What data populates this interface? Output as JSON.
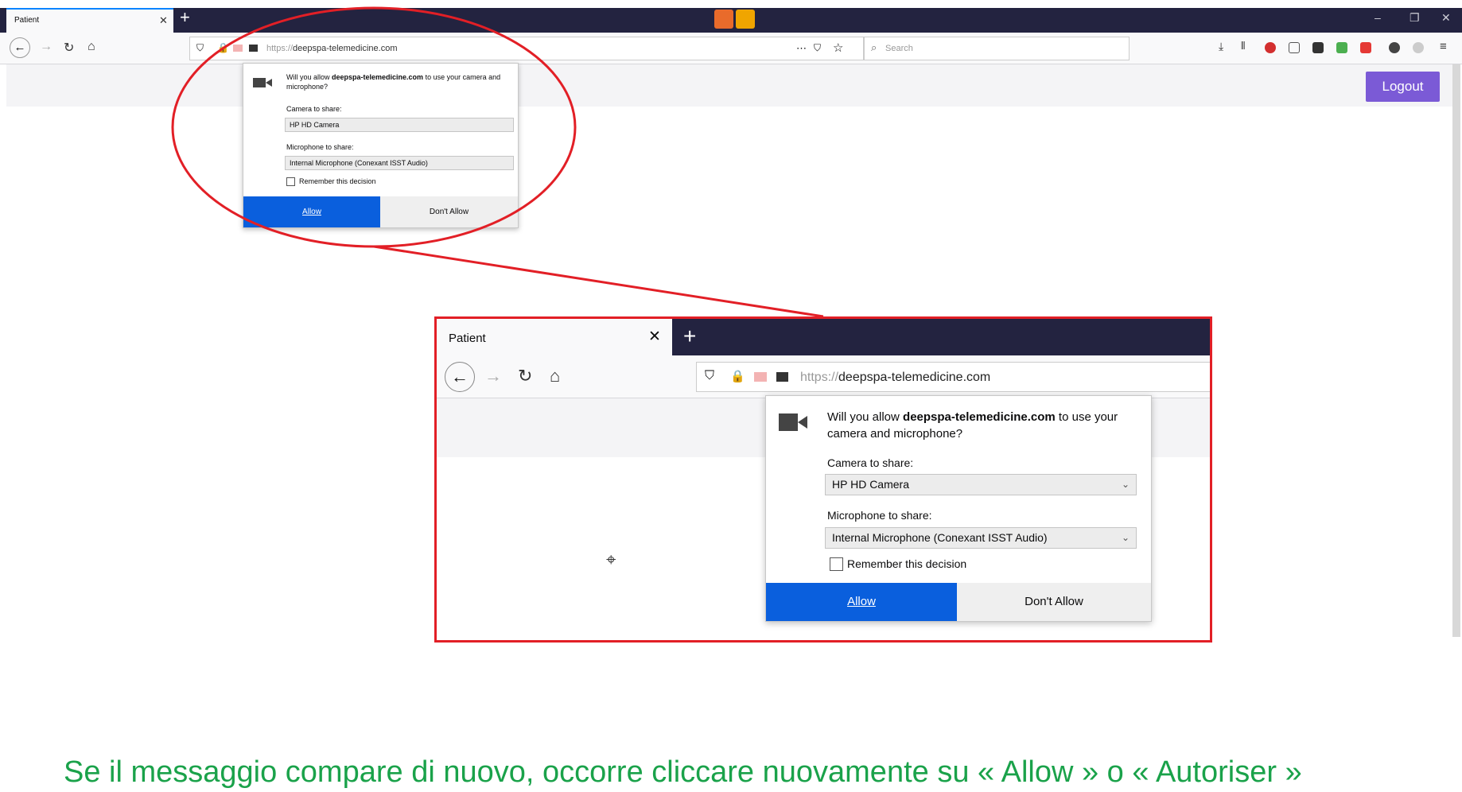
{
  "browser": {
    "tab_title": "Patient",
    "tab_close": "✕",
    "new_tab": "+",
    "url_scheme": "https://",
    "url_host": "deepspa-telemedicine.com",
    "search_placeholder": "Search",
    "window_controls": [
      "–",
      "❐",
      "✕"
    ]
  },
  "page": {
    "logout_label": "Logout"
  },
  "permission_popup": {
    "question_prefix": "Will you allow ",
    "site": "deepspa-telemedicine.com",
    "question_suffix": " to use your camera and microphone?",
    "camera_label": "Camera to share:",
    "camera_value": "HP HD Camera",
    "microphone_label": "Microphone to share:",
    "microphone_value": "Internal Microphone (Conexant ISST Audio)",
    "remember_label": "Remember this decision",
    "allow_label": "Allow",
    "deny_label": "Don't Allow"
  },
  "caption": "Se il messaggio compare di nuovo, occorre cliccare nuovamente su « Allow » o « Autoriser »",
  "colors": {
    "highlight": "#e21f26",
    "allow_button": "#0a5fdd",
    "logout_button": "#7b5ad6",
    "caption_text": "#1aa24a"
  }
}
